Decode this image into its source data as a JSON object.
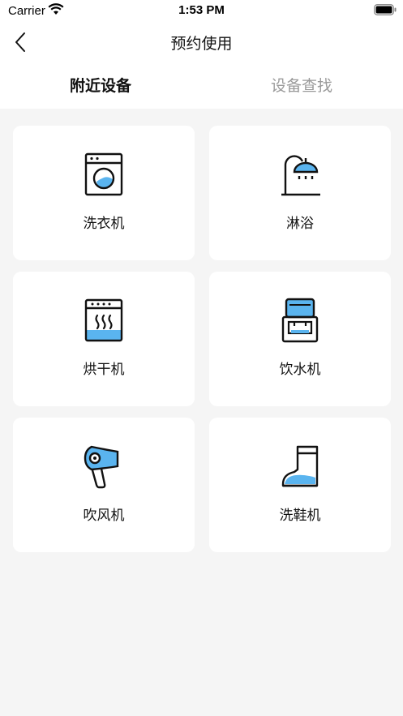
{
  "status_bar": {
    "carrier": "Carrier",
    "time": "1:53 PM"
  },
  "nav": {
    "title": "预约使用"
  },
  "tabs": [
    {
      "label": "附近设备",
      "active": true
    },
    {
      "label": "设备查找",
      "active": false
    }
  ],
  "devices": [
    {
      "label": "洗衣机",
      "icon": "washing-machine-icon"
    },
    {
      "label": "淋浴",
      "icon": "shower-icon"
    },
    {
      "label": "烘干机",
      "icon": "dryer-icon"
    },
    {
      "label": "饮水机",
      "icon": "water-dispenser-icon"
    },
    {
      "label": "吹风机",
      "icon": "hair-dryer-icon"
    },
    {
      "label": "洗鞋机",
      "icon": "shoe-washer-icon"
    }
  ],
  "colors": {
    "accent": "#5ab4ef",
    "icon_stroke": "#111111",
    "background": "#f5f5f5",
    "card": "#ffffff",
    "tab_inactive": "#9a9a9a"
  }
}
